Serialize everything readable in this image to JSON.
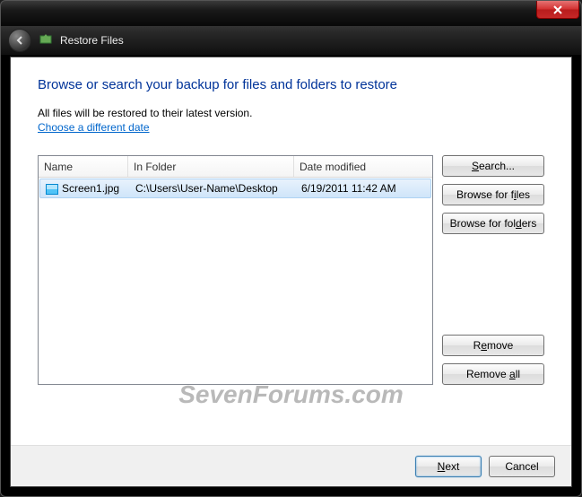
{
  "header": {
    "title": "Restore Files"
  },
  "main": {
    "heading": "Browse or search your backup for files and folders to restore",
    "subtext": "All files will be restored to their latest version.",
    "link": "Choose a different date"
  },
  "list": {
    "columns": {
      "name": "Name",
      "folder": "In Folder",
      "date": "Date modified"
    },
    "rows": [
      {
        "name": "Screen1.jpg",
        "folder": "C:\\Users\\User-Name\\Desktop",
        "date": "6/19/2011 11:42 AM"
      }
    ]
  },
  "buttons": {
    "search": "Search...",
    "browse_files": "Browse for files",
    "browse_folders": "Browse for folders",
    "remove": "Remove",
    "remove_all": "Remove all",
    "next": "Next",
    "cancel": "Cancel"
  },
  "watermark": "SevenForums.com"
}
